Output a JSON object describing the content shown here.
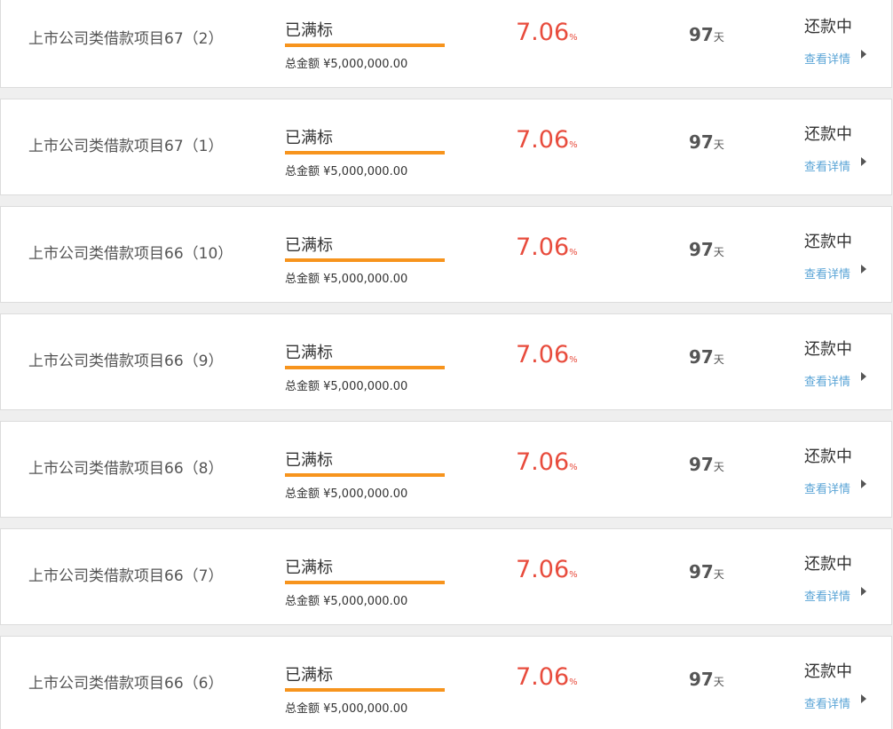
{
  "loans": [
    {
      "title": "上市公司类借款项目67（2）",
      "status": "已满标",
      "progress": 1.0,
      "total": "总金额 ¥5,000,000.00",
      "rate": "7.06",
      "rate_unit": "%",
      "term": "97",
      "term_unit": "天",
      "repay_status": "还款中",
      "detail_label": "查看详情"
    },
    {
      "title": "上市公司类借款项目67（1）",
      "status": "已满标",
      "progress": 1.0,
      "total": "总金额 ¥5,000,000.00",
      "rate": "7.06",
      "rate_unit": "%",
      "term": "97",
      "term_unit": "天",
      "repay_status": "还款中",
      "detail_label": "查看详情"
    },
    {
      "title": "上市公司类借款项目66（10）",
      "status": "已满标",
      "progress": 1.0,
      "total": "总金额 ¥5,000,000.00",
      "rate": "7.06",
      "rate_unit": "%",
      "term": "97",
      "term_unit": "天",
      "repay_status": "还款中",
      "detail_label": "查看详情"
    },
    {
      "title": "上市公司类借款项目66（9）",
      "status": "已满标",
      "progress": 1.0,
      "total": "总金额 ¥5,000,000.00",
      "rate": "7.06",
      "rate_unit": "%",
      "term": "97",
      "term_unit": "天",
      "repay_status": "还款中",
      "detail_label": "查看详情"
    },
    {
      "title": "上市公司类借款项目66（8）",
      "status": "已满标",
      "progress": 1.0,
      "total": "总金额 ¥5,000,000.00",
      "rate": "7.06",
      "rate_unit": "%",
      "term": "97",
      "term_unit": "天",
      "repay_status": "还款中",
      "detail_label": "查看详情"
    },
    {
      "title": "上市公司类借款项目66（7）",
      "status": "已满标",
      "progress": 1.0,
      "total": "总金额 ¥5,000,000.00",
      "rate": "7.06",
      "rate_unit": "%",
      "term": "97",
      "term_unit": "天",
      "repay_status": "还款中",
      "detail_label": "查看详情"
    },
    {
      "title": "上市公司类借款项目66（6）",
      "status": "已满标",
      "progress": 1.0,
      "total": "总金额 ¥5,000,000.00",
      "rate": "7.06",
      "rate_unit": "%",
      "term": "97",
      "term_unit": "天",
      "repay_status": "还款中",
      "detail_label": "查看详情"
    }
  ],
  "colors": {
    "rate": "#e84c3d",
    "progress_bar": "#f7941d",
    "detail_link": "#5aa4d6"
  },
  "icons": {
    "detail_arrow": "caret-right-icon"
  }
}
